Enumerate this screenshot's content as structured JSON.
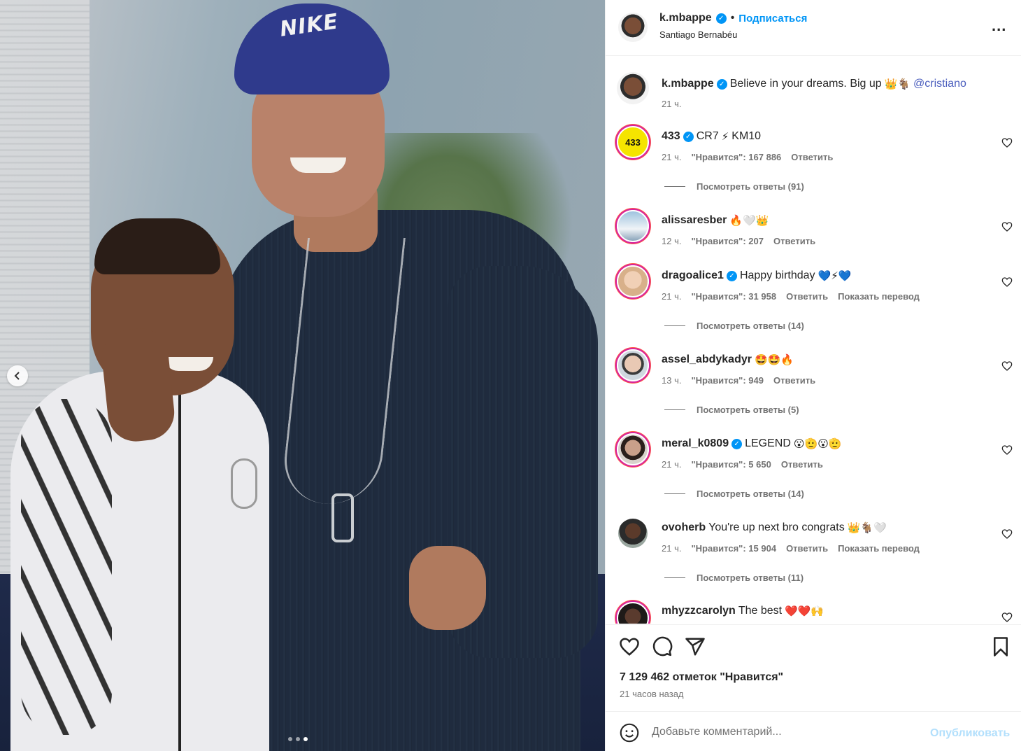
{
  "post": {
    "carousel": {
      "slides": 3,
      "active_slide": 3
    },
    "header": {
      "username": "k.mbappe",
      "separator": "•",
      "follow_label": "Подписаться",
      "location": "Santiago Bernabéu",
      "more_label": "..."
    },
    "caption": {
      "username": "k.mbappe",
      "text": "Believe in your dreams. Big up",
      "emoji": "👑🐐",
      "mention": "@cristiano",
      "time": "21 ч."
    },
    "comments": [
      {
        "username": "433",
        "verified": true,
        "text": "CR7",
        "emoji": "⚡",
        "text2": "KM10",
        "time": "21 ч.",
        "likes": "\"Нравится\": 167 886",
        "reply": "Ответить",
        "replies": "Посмотреть ответы (91)"
      },
      {
        "username": "alissaresber",
        "verified": false,
        "text": "",
        "emoji": "🔥🤍👑",
        "time": "12 ч.",
        "likes": "\"Нравится\": 207",
        "reply": "Ответить"
      },
      {
        "username": "dragoalice1",
        "verified": true,
        "text": "Happy birthday",
        "emoji": "💙⚡💙",
        "time": "21 ч.",
        "likes": "\"Нравится\": 31 958",
        "reply": "Ответить",
        "translate": "Показать перевод",
        "replies": "Посмотреть ответы (14)"
      },
      {
        "username": "assel_abdykadyr",
        "verified": false,
        "text": "",
        "emoji": "🤩🤩🔥",
        "time": "13 ч.",
        "likes": "\"Нравится\": 949",
        "reply": "Ответить",
        "replies": "Посмотреть ответы (5)"
      },
      {
        "username": "meral_k0809",
        "verified": true,
        "text": "LEGEND",
        "emoji": "😮🫡😮🫡",
        "time": "21 ч.",
        "likes": "\"Нравится\": 5 650",
        "reply": "Ответить",
        "replies": "Посмотреть ответы (14)"
      },
      {
        "username": "ovoherb",
        "verified": false,
        "text": "You're up next bro congrats",
        "emoji": "👑🐐🤍",
        "time": "21 ч.",
        "likes": "\"Нравится\": 15 904",
        "reply": "Ответить",
        "translate": "Показать перевод",
        "replies": "Посмотреть ответы (11)"
      },
      {
        "username": "mhyzzcarolyn",
        "verified": false,
        "text": "The best",
        "emoji": "❤️❤️🙌"
      }
    ],
    "likes_total": "7 129 462 отметок \"Нравится\"",
    "posted_ago": "21 часов назад",
    "composer": {
      "placeholder": "Добавьте комментарий...",
      "publish_label": "Опубликовать"
    },
    "colors": {
      "accent": "#0095f6",
      "muted": "#737373",
      "publish_disabled": "#b2dffc"
    }
  }
}
